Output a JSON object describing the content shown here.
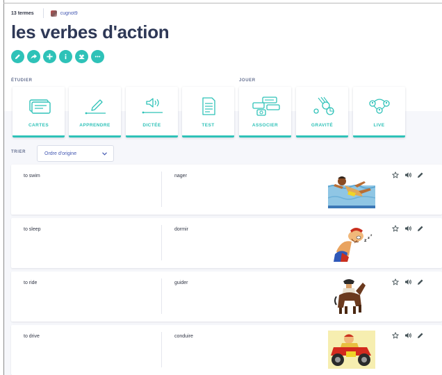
{
  "header": {
    "term_count": "13 termes",
    "username": "cugnot9",
    "title": "les verbes d'action"
  },
  "actions": [
    "edit-icon",
    "share-icon",
    "add-icon",
    "info-icon",
    "class-icon",
    "more-icon"
  ],
  "sections": {
    "study_label": "ÉTUDIER",
    "play_label": "JOUER"
  },
  "modes": [
    {
      "label": "CARTES",
      "icon": "flashcards-icon"
    },
    {
      "label": "APPRENDRE",
      "icon": "learn-icon"
    },
    {
      "label": "DICTÉE",
      "icon": "dictation-icon"
    },
    {
      "label": "TEST",
      "icon": "test-icon"
    },
    {
      "label": "ASSOCIER",
      "icon": "match-icon"
    },
    {
      "label": "GRAVITÉ",
      "icon": "gravity-icon"
    },
    {
      "label": "LIVE",
      "icon": "live-icon"
    }
  ],
  "sort": {
    "label": "TRIER",
    "value": "Ordre d'origine"
  },
  "terms": [
    {
      "term": "to swim",
      "definition": "nager",
      "image": "swimmer-image"
    },
    {
      "term": "to sleep",
      "definition": "dormir",
      "image": "sleeping-person-image"
    },
    {
      "term": "to ride",
      "definition": "guider",
      "image": "horse-rider-image"
    },
    {
      "term": "to drive",
      "definition": "conduire",
      "image": "car-driver-image"
    }
  ],
  "colors": {
    "accent": "#2ec2b8",
    "title": "#2e3856",
    "link": "#4257b2",
    "band": "#f6f7fb"
  }
}
